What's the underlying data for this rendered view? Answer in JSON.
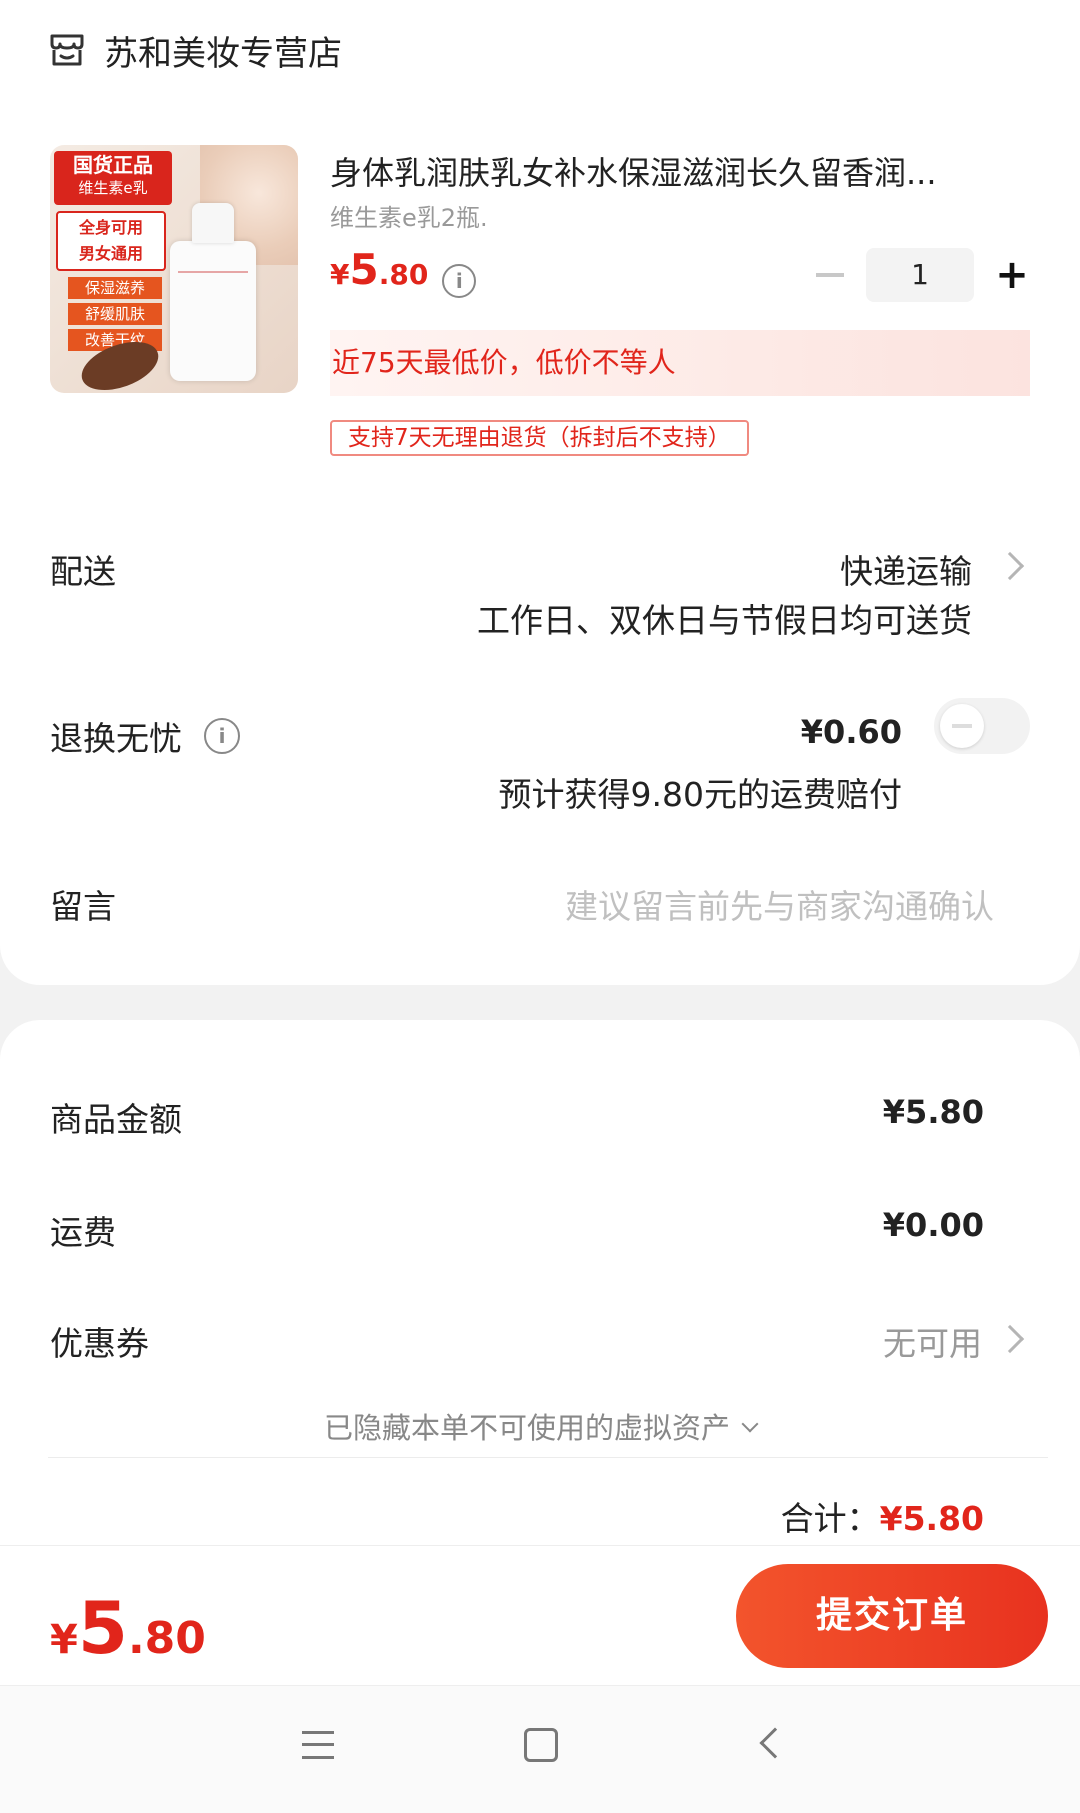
{
  "shop": {
    "name": "苏和美妆专营店",
    "icon": "shop-icon"
  },
  "product": {
    "title": "身体乳润肤乳女补水保湿滋润长久留香润...",
    "sku": "维生素e乳2瓶.",
    "price_symbol": "¥",
    "price_int": "5",
    "price_dec": ".80",
    "quantity": "1",
    "low_price_note": "近75天最低价，低价不等人",
    "return_policy_tag": "支持7天无理由退货（拆封后不支持）",
    "image_text": {
      "badge_main": "国货正品",
      "badge_sub": "维生素e乳",
      "box_line1": "全身可用",
      "box_line2": "男女通用",
      "tags": [
        "保湿滋养",
        "舒缓肌肤",
        "改善干纹"
      ]
    }
  },
  "shipping": {
    "label": "配送",
    "value": "快递运输",
    "sub": "工作日、双休日与节假日均可送货"
  },
  "return_insurance": {
    "label": "退换无忧",
    "price": "¥0.60",
    "sub": "预计获得9.80元的运费赔付",
    "enabled": false
  },
  "message": {
    "label": "留言",
    "placeholder": "建议留言前先与商家沟通确认"
  },
  "summary": {
    "goods_label": "商品金额",
    "goods_value": "¥5.80",
    "freight_label": "运费",
    "freight_value": "¥0.00",
    "coupon_label": "优惠券",
    "coupon_value": "无可用",
    "hidden_assets": "已隐藏本单不可使用的虚拟资产",
    "total_label": "合计：",
    "total_value": "¥5.80"
  },
  "bottom_bar": {
    "price_symbol": "¥",
    "price_int": "5",
    "price_dec": ".80",
    "submit_label": "提交订单"
  },
  "colors": {
    "accent": "#e1251b",
    "button_start": "#f3542c",
    "button_end": "#e8321f"
  }
}
